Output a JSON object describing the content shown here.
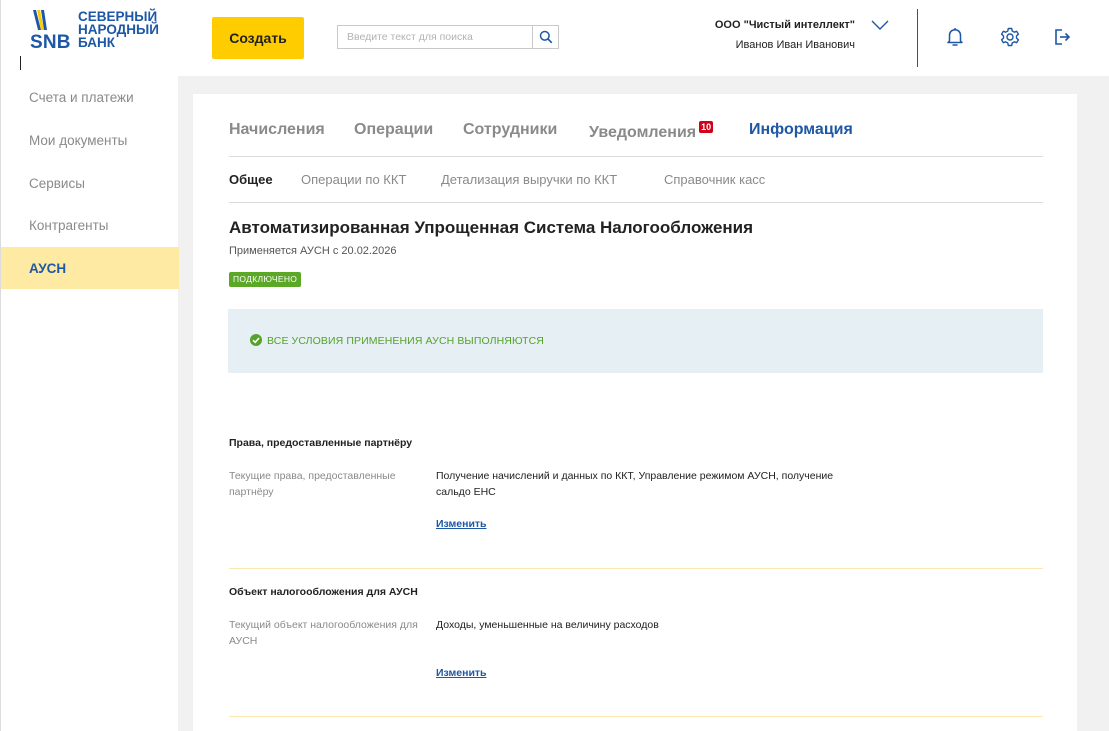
{
  "logo": {
    "abbr": "SNB",
    "name_line1": "СЕВЕРНЫЙ",
    "name_line2": "НАРОДНЫЙ",
    "name_line3": "БАНК",
    "color": "#1d57a5"
  },
  "header": {
    "create_label": "Создать",
    "search_placeholder": "Введите текст для поиска",
    "org_name": "ООО \"Чистый интеллект\"",
    "user_name": "Иванов Иван Иванович",
    "icons": [
      "bell-icon",
      "gear-icon",
      "logout-icon"
    ]
  },
  "sidebar": {
    "items": [
      {
        "label": "Счета и платежи",
        "active": false
      },
      {
        "label": "Мои документы",
        "active": false
      },
      {
        "label": "Сервисы",
        "active": false
      },
      {
        "label": "Контрагенты",
        "active": false
      },
      {
        "label": "АУСН",
        "active": true
      }
    ]
  },
  "tabs": [
    {
      "label": "Начисления",
      "active": false
    },
    {
      "label": "Операции",
      "active": false
    },
    {
      "label": "Сотрудники",
      "active": false
    },
    {
      "label": "Уведомления",
      "active": false,
      "badge": "10"
    },
    {
      "label": "Информация",
      "active": true
    }
  ],
  "subtabs": [
    {
      "label": "Общее",
      "active": true
    },
    {
      "label": "Операции по ККТ",
      "active": false
    },
    {
      "label": "Детализация выручки по ККТ",
      "active": false
    },
    {
      "label": "Справочник касс",
      "active": false
    }
  ],
  "main": {
    "title": "Автоматизированная Упрощенная Система Налогообложения",
    "applied_since": "Применяется АУСН с 20.02.2026",
    "status": "ПОДКЛЮЧЕНО",
    "alert_text": "ВСЕ УСЛОВИЯ ПРИМЕНЕНИЯ АУСН ВЫПОЛНЯЮТСЯ"
  },
  "sections": [
    {
      "title": "Права, предоставленные партнёру",
      "label": "Текущие права, предоставленные партнёру",
      "value": "Получение начислений и данных по ККТ, Управление режимом АУСН, получение сальдо ЕНС",
      "action": "Изменить"
    },
    {
      "title": "Объект налогообложения для АУСН",
      "label": "Текущий объект налогообложения для АУСН",
      "value": "Доходы, уменьшенные на величину расходов",
      "action": "Изменить"
    }
  ],
  "colors": {
    "brand": "#1d57a5",
    "accent": "#ffcc00",
    "active_bg": "#ffeaa3",
    "success": "#5ba826",
    "badge": "#d0021b"
  }
}
